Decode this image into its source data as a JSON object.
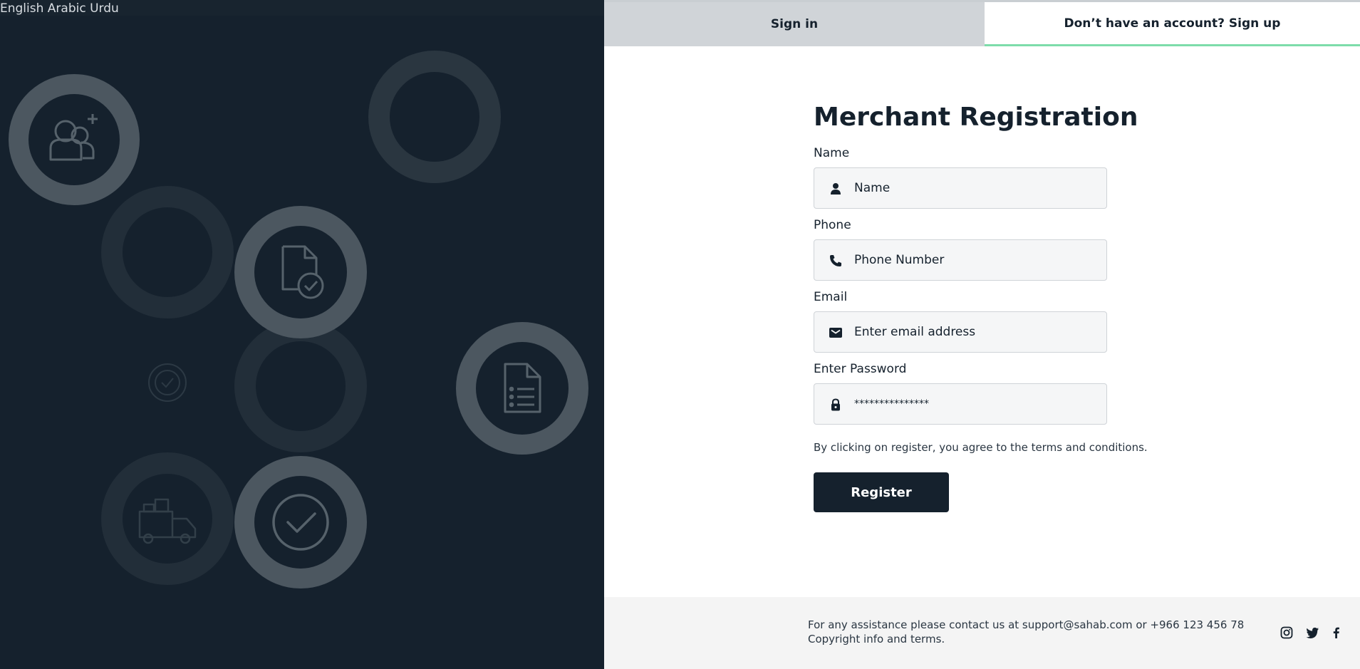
{
  "languages": [
    "English",
    "Arabic",
    "Urdu"
  ],
  "tabs": {
    "signin": "Sign in",
    "signup": "Don’t have an account? Sign up"
  },
  "form": {
    "title": "Merchant Registration",
    "name": {
      "label": "Name",
      "placeholder": "Name",
      "icon": "user-icon"
    },
    "phone": {
      "label": "Phone",
      "placeholder": "Phone Number",
      "icon": "phone-icon"
    },
    "email": {
      "label": "Email",
      "placeholder": "Enter email address",
      "icon": "envelope-icon"
    },
    "password": {
      "label": "Enter Password",
      "value": "***************",
      "icon": "lock-icon"
    },
    "terms": "By clicking on register, you agree to the terms and conditions.",
    "register_label": "Register"
  },
  "footer": {
    "contact": "For any assistance please contact us at support@sahab.com or +966 123 456 78",
    "copyright": "Copyright info and terms.",
    "social_icons": [
      "instagram-icon",
      "twitter-icon",
      "facebook-icon"
    ]
  },
  "colors": {
    "dark": "#15212d",
    "accent": "#7ddcaa",
    "ring": "#4c5760"
  }
}
